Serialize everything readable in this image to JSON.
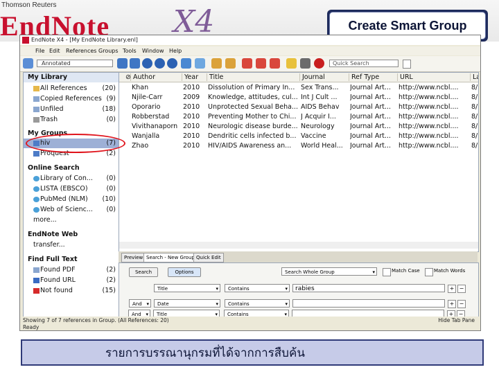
{
  "banner": {
    "publisher": "Thomson Reuters",
    "logo": "EndNote",
    "logo_suffix": "X4",
    "slide_title": "Create Smart Group"
  },
  "window": {
    "title": "EndNote X4 - [My EndNote Library.enl]",
    "menu": [
      "File",
      "Edit",
      "References",
      "Groups",
      "Tools",
      "Window",
      "Help"
    ],
    "style": "Annotated",
    "quick_search_placeholder": "Quick Search"
  },
  "left_pane": {
    "my_library_label": "My Library",
    "items": [
      {
        "label": "All References",
        "count": "(20)"
      },
      {
        "label": "Copied References",
        "count": "(9)"
      },
      {
        "label": "Unfiled",
        "count": "(18)"
      },
      {
        "label": "Trash",
        "count": "(0)"
      }
    ],
    "my_groups_label": "My Groups",
    "groups": [
      {
        "label": "hiv",
        "count": "(7)"
      },
      {
        "label": "Proquest",
        "count": "(2)"
      }
    ],
    "online_search_label": "Online Search",
    "online": [
      {
        "label": "Library of Con...",
        "count": "(0)"
      },
      {
        "label": "LISTA (EBSCO)",
        "count": "(0)"
      },
      {
        "label": "PubMed (NLM)",
        "count": "(10)"
      },
      {
        "label": "Web of Scienc...",
        "count": "(0)"
      }
    ],
    "more_label": "more...",
    "endnote_web_label": "EndNote Web",
    "transfer_label": "transfer...",
    "find_full_text_label": "Find Full Text",
    "fft": [
      {
        "label": "Found PDF",
        "count": "(2)"
      },
      {
        "label": "Found URL",
        "count": "(2)"
      },
      {
        "label": "Not found",
        "count": "(15)"
      }
    ]
  },
  "ref_list": {
    "columns": [
      "Author",
      "Year",
      "Title",
      "Journal",
      "Ref Type",
      "URL",
      "La"
    ],
    "rows": [
      {
        "author": "Khan",
        "year": "2010",
        "title": "Dissolution of Primary In...",
        "journal": "Sex Trans...",
        "reftype": "Journal Art...",
        "url": "http://www.ncbl....",
        "la": "8/"
      },
      {
        "author": "Njile-Carr",
        "year": "2009",
        "title": "Knowledge, attitudes, cul...",
        "journal": "Int J Cult ...",
        "reftype": "Journal Art...",
        "url": "http://www.ncbl....",
        "la": "8/"
      },
      {
        "author": "Oporario",
        "year": "2010",
        "title": "Unprotected Sexual Beha...",
        "journal": "AIDS Behav",
        "reftype": "Journal Art...",
        "url": "http://www.ncbl....",
        "la": "8/"
      },
      {
        "author": "Robberstad",
        "year": "2010",
        "title": "Preventing Mother to Chi...",
        "journal": "J Acquir I...",
        "reftype": "Journal Art...",
        "url": "http://www.ncbl....",
        "la": "8/"
      },
      {
        "author": "Vivithanaporn",
        "year": "2010",
        "title": "Neurologic disease burde...",
        "journal": "Neurology",
        "reftype": "Journal Art...",
        "url": "http://www.ncbl....",
        "la": "8/"
      },
      {
        "author": "Wanjalla",
        "year": "2010",
        "title": "Dendritic cells infected b...",
        "journal": "Vaccine",
        "reftype": "Journal Art...",
        "url": "http://www.ncbl....",
        "la": "8/"
      },
      {
        "author": "Zhao",
        "year": "2010",
        "title": "HIV/AIDS Awareness an...",
        "journal": "World Heal...",
        "reftype": "Journal Art...",
        "url": "http://www.ncbl....",
        "la": "8/"
      }
    ]
  },
  "tabs": {
    "preview": "Preview",
    "search": "Search - New Group",
    "quick_edit": "Quick Edit"
  },
  "search_panel": {
    "search_button": "Search",
    "options_button": "Options",
    "scope": "Search Whole Group",
    "match_case": "Match Case",
    "match_words": "Match Words",
    "rows": [
      {
        "bool": "",
        "field": "Title",
        "op": "Contains",
        "value": "rabies"
      },
      {
        "bool": "And",
        "field": "Date",
        "op": "Contains",
        "value": ""
      },
      {
        "bool": "And",
        "field": "Title",
        "op": "Contains",
        "value": ""
      }
    ]
  },
  "status": {
    "line1": "Showing 7 of 7 references in Group. (All References: 20)",
    "line2": "Ready",
    "hide_tab": "Hide Tab Pane"
  },
  "caption": "รายการบรรณานุกรมที่ได้จากการสืบค้น",
  "colors": {
    "accent_red": "#c8102e",
    "selection": "#9db0d6",
    "annotation_red": "#e0141c",
    "caption_bg": "#c6cbe8"
  }
}
